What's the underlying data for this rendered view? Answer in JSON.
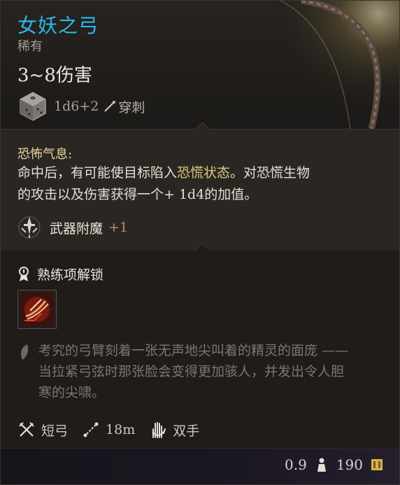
{
  "item": {
    "name": "女妖之弓",
    "rarity": "稀有",
    "damage": "3~8伤害",
    "dice": "1d6+2",
    "damage_type": "穿刺"
  },
  "passive": {
    "title": "恐怖气息:",
    "text_before": "命中后，有可能使目标陷入",
    "text_highlight": "恐慌状态",
    "text_line1_after": "。对恐慌生物",
    "text_line2": "的攻击以及伤害获得一个+ 1d4的加值。"
  },
  "enchant": {
    "label": "武器附魔",
    "value": "+1"
  },
  "proficiency": {
    "label": "熟练项解锁"
  },
  "lore": {
    "lines": [
      "考究的弓臂刻着一张无声地尖叫着的精灵的面庞 ——",
      "当拉紧弓弦时那张脸会变得更加骇人，并发出令人胆",
      "寒的尖啸。"
    ]
  },
  "properties": {
    "weapon_type": "短弓",
    "range": "18m",
    "handedness": "双手"
  },
  "footer": {
    "weight": "0.9",
    "value": "190"
  },
  "colors": {
    "title": "#2fb6e8",
    "highlight": "#e0c77f",
    "enchant_value": "#b18e5e"
  },
  "icons": {
    "dice": "dice-icon",
    "damage_type": "piercing-icon",
    "enchant": "sword-enchant-icon",
    "proficiency": "proficiency-icon",
    "skill": "skill-icon",
    "lore": "feather-icon",
    "weapon_type": "crossed-swords-icon",
    "range": "range-icon",
    "handedness": "two-hands-icon",
    "weight": "weight-icon",
    "gold": "gold-icon"
  }
}
